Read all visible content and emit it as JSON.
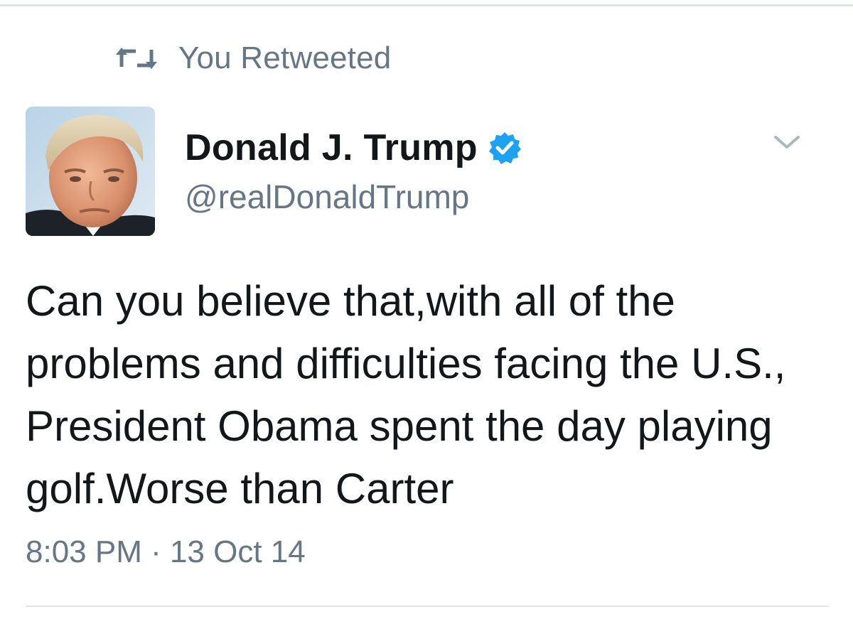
{
  "retweet_context": {
    "icon": "retweet-icon",
    "label": "You Retweeted"
  },
  "tweet": {
    "author": {
      "name": "Donald J. Trump",
      "handle": "@realDonaldTrump",
      "verified": true,
      "verified_icon": "verified-badge-icon",
      "avatar": "avatar-photo"
    },
    "menu_icon": "chevron-down-icon",
    "text": "Can you believe that,with all of the problems and difficulties facing the U.S., President Obama spent the day playing golf.Worse than Carter",
    "timestamp": "8:03 PM · 13 Oct 14"
  },
  "colors": {
    "text_primary": "#14171a",
    "text_secondary": "#657786",
    "verified_blue": "#1da1f2",
    "divider": "#e1e4e7"
  }
}
